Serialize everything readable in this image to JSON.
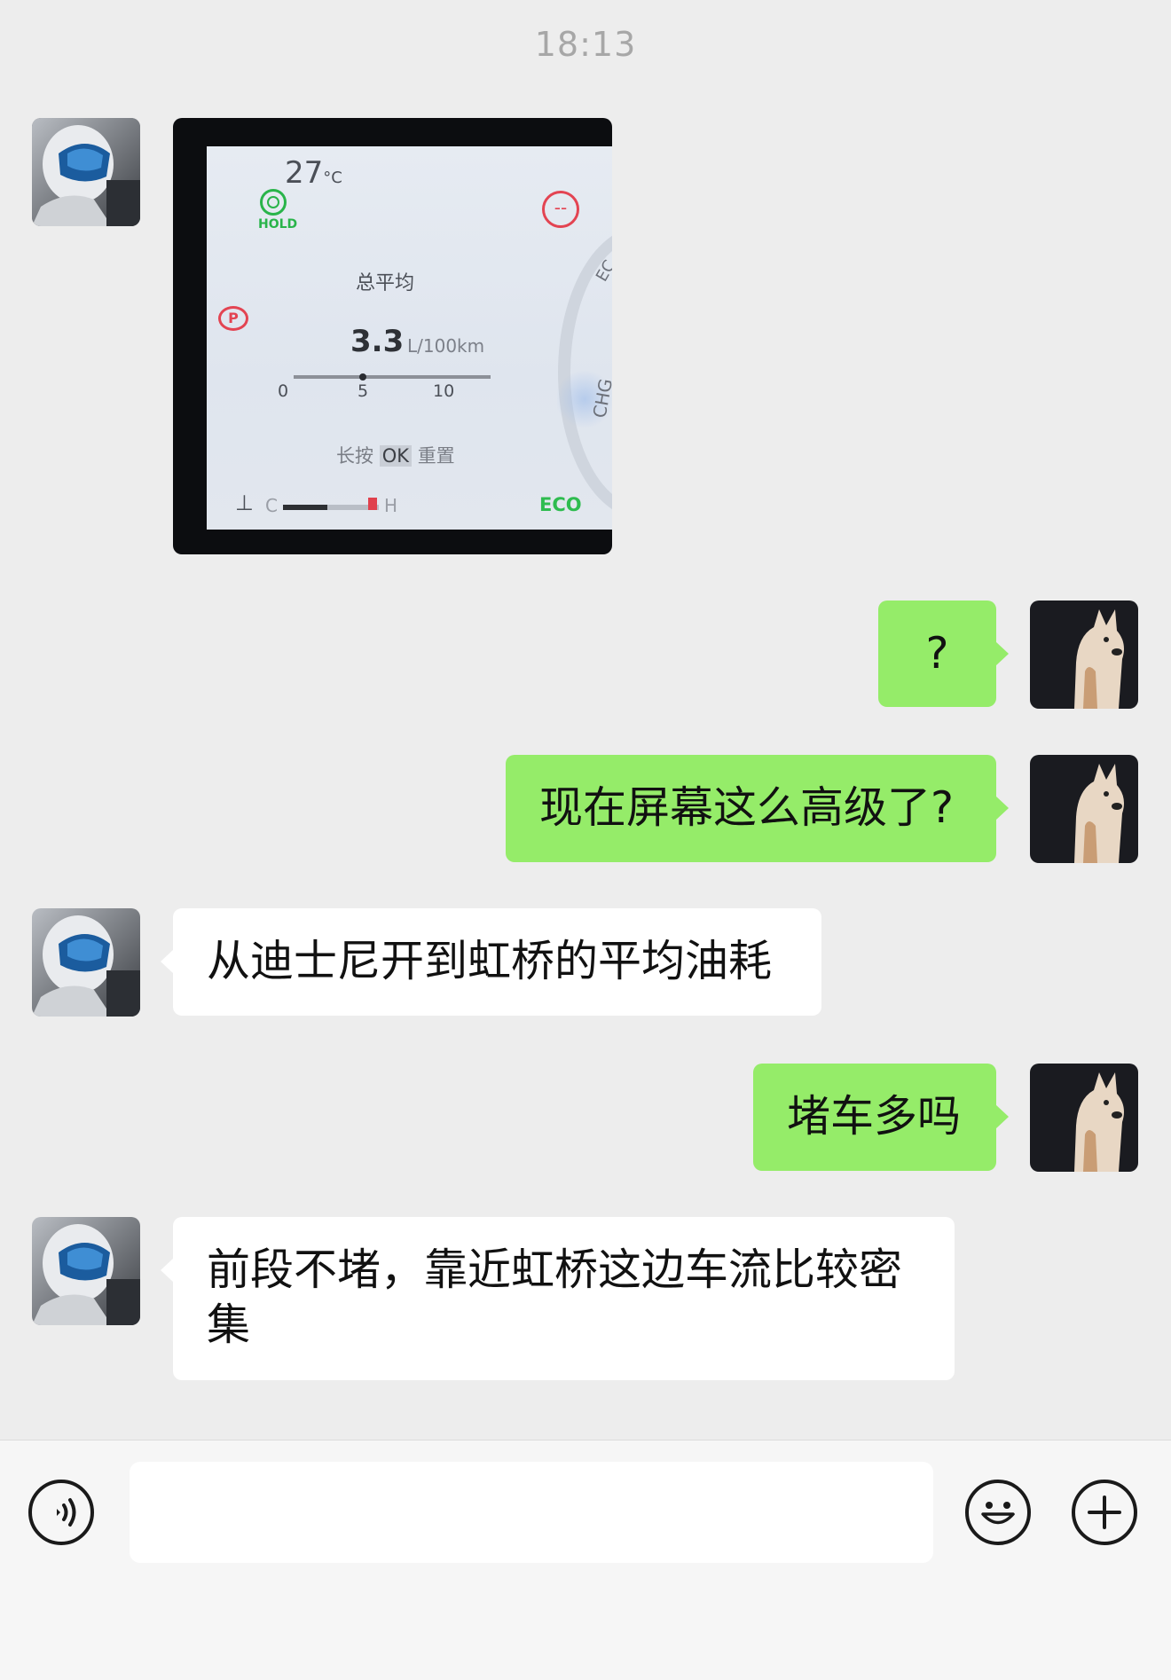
{
  "timestamp": "18:13",
  "icons": {
    "left_avatar": "helmet-avatar-icon",
    "right_avatar": "dog-avatar-icon",
    "voice": "voice-icon",
    "emoji": "emoji-icon",
    "plus": "plus-icon"
  },
  "colors": {
    "background": "#ededed",
    "incoming_bubble": "#ffffff",
    "outgoing_bubble": "#95ec69",
    "timestamp": "#a7a7a7"
  },
  "dashboard_photo": {
    "temperature": "27",
    "temperature_unit": "°C",
    "hold_label": "HOLD",
    "parking_label": "P",
    "warning_label": "--",
    "average_title": "总平均",
    "average_value": "3.3",
    "average_unit": "L/100km",
    "scale": [
      "0",
      "5",
      "10"
    ],
    "reset_hint_pre": "长按",
    "reset_hint_key": "OK",
    "reset_hint_post": "重置",
    "coolant_low": "C",
    "coolant_high": "H",
    "eco_label": "ECO",
    "chg_label": "CHG",
    "ec_label": "EC"
  },
  "messages": [
    {
      "side": "out",
      "text": "?"
    },
    {
      "side": "out",
      "text": "现在屏幕这么高级了?"
    },
    {
      "side": "in",
      "text": "从迪士尼开到虹桥的平均油耗"
    },
    {
      "side": "out",
      "text": "堵车多吗"
    },
    {
      "side": "in",
      "text": "前段不堵，靠近虹桥这边车流比较密集"
    }
  ],
  "input": {
    "value": "",
    "placeholder": ""
  }
}
